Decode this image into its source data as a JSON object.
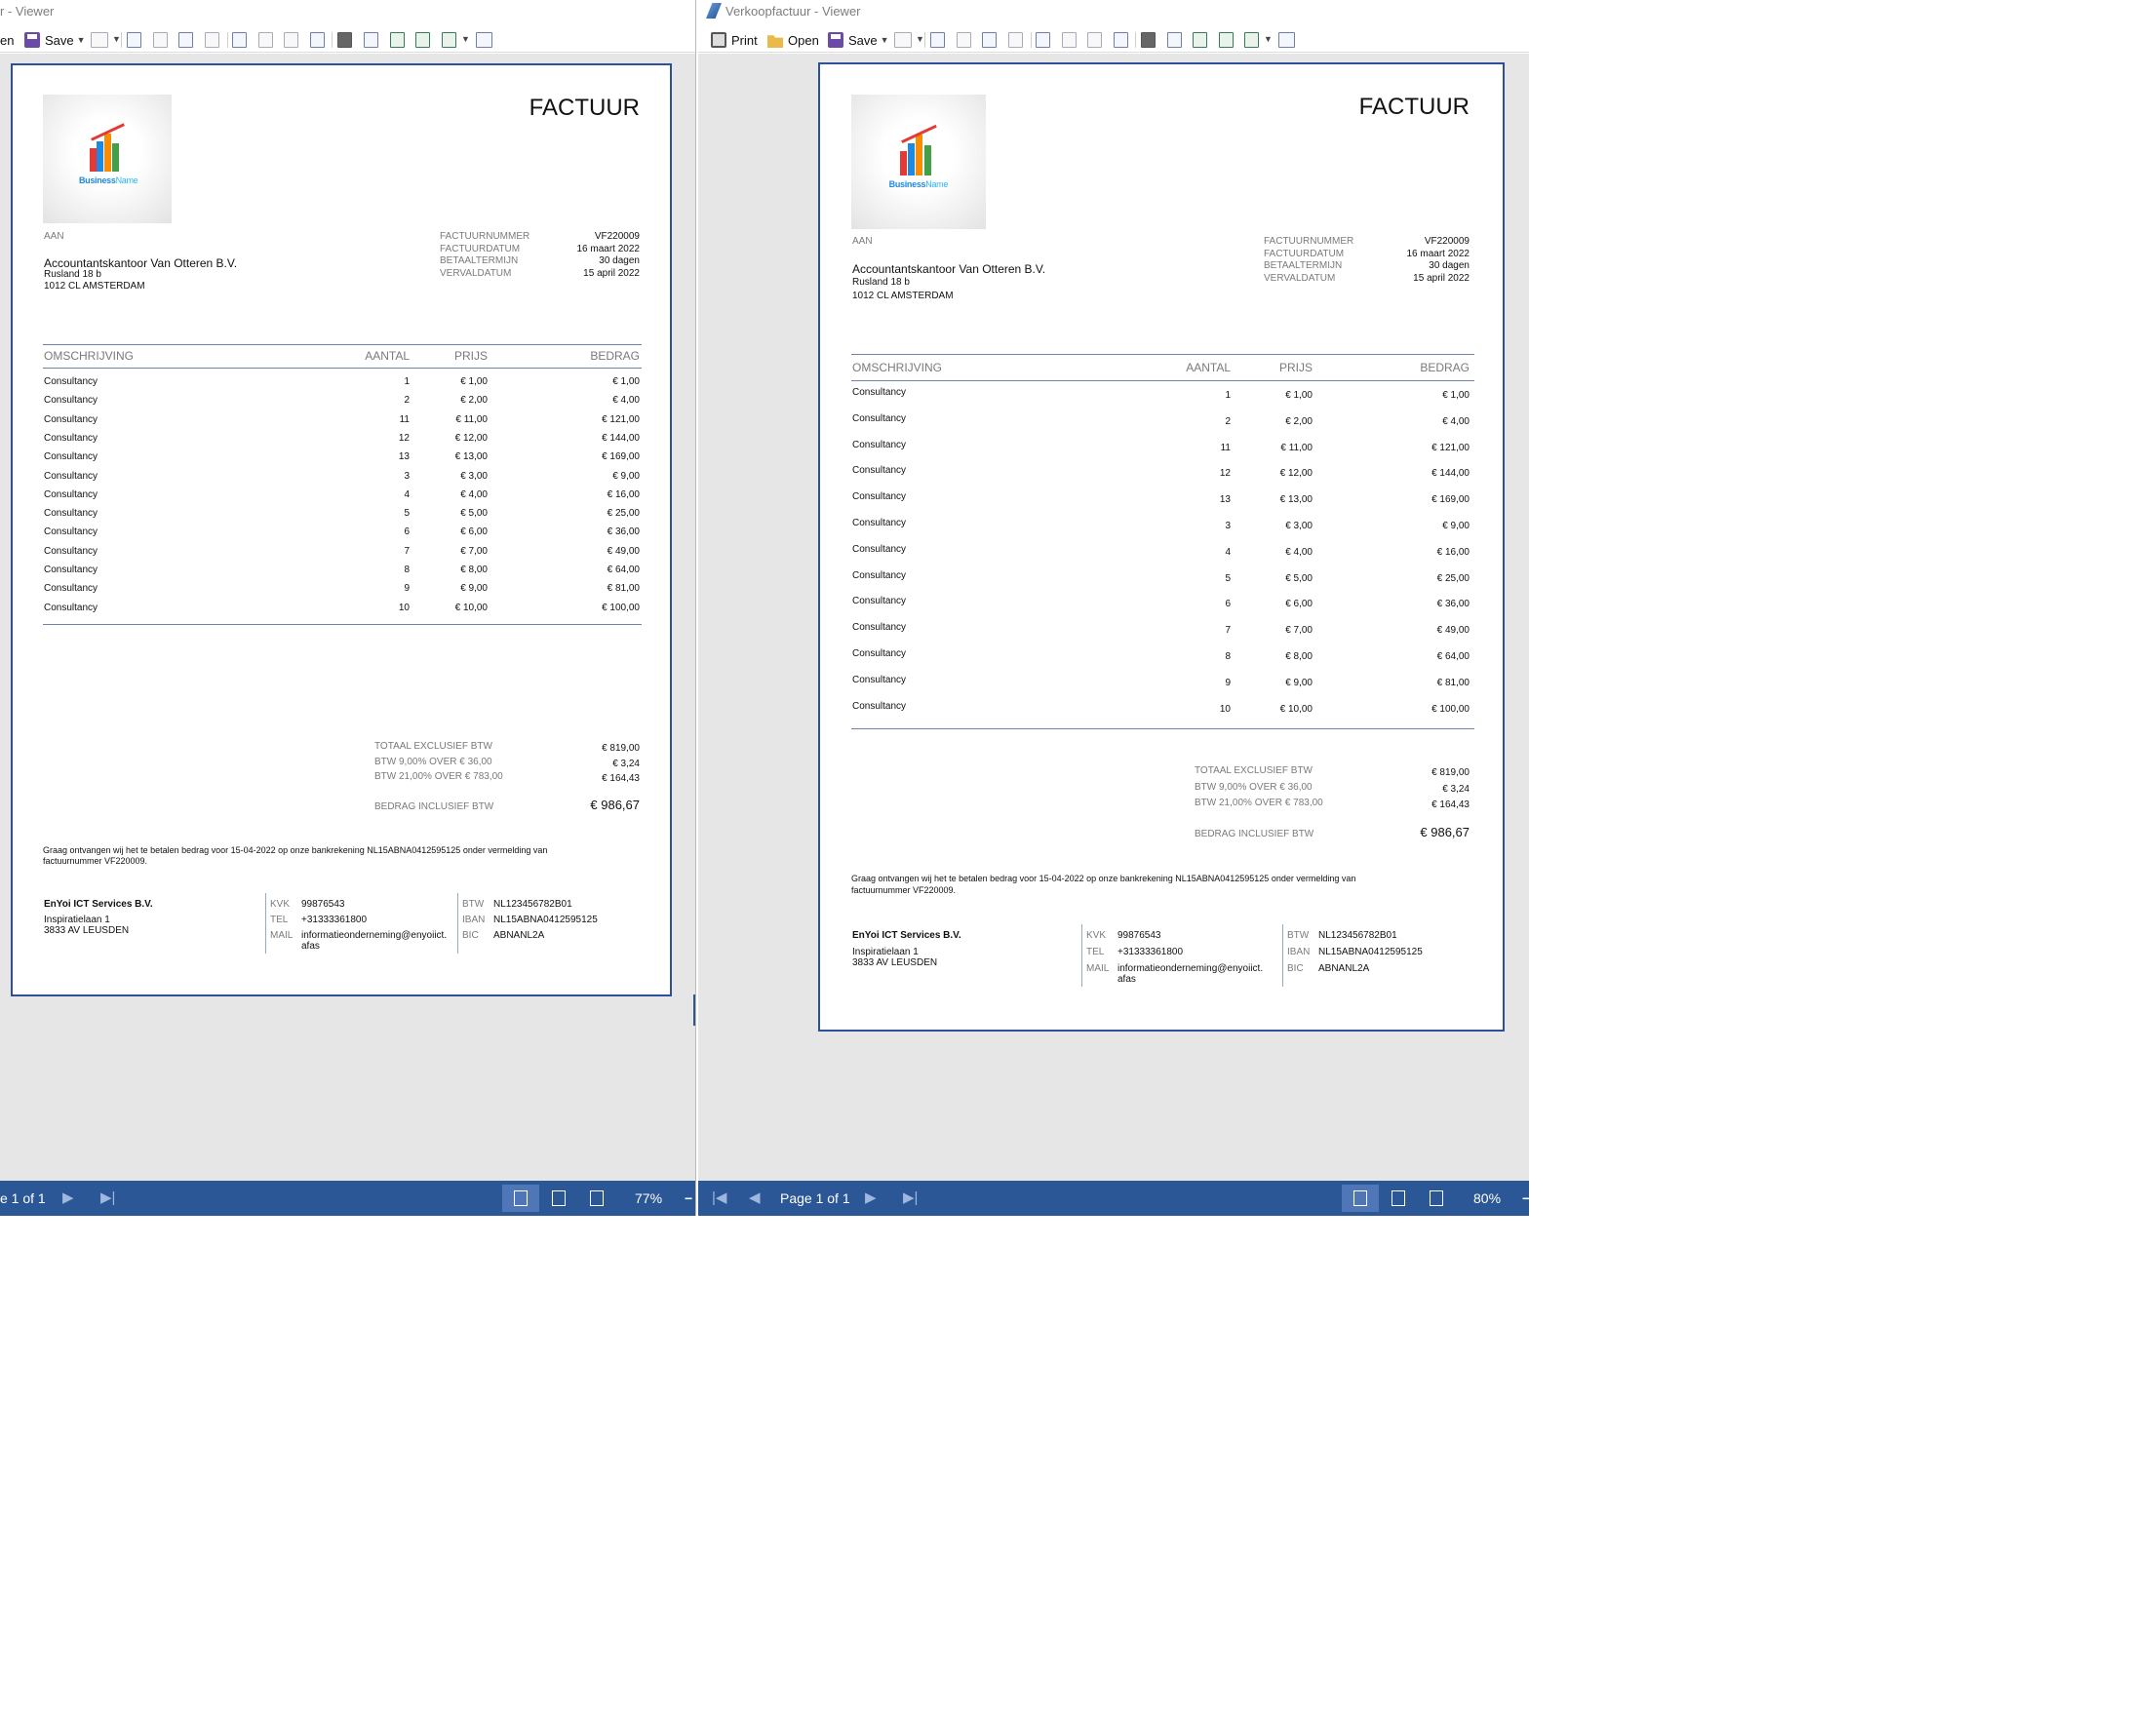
{
  "left_window": {
    "title": "r - Viewer",
    "toolbar": {
      "open_label": "en",
      "save_label": "Save"
    },
    "status": {
      "page_text": "e 1 of 1",
      "zoom": "77%"
    }
  },
  "right_window": {
    "title": "Verkoopfactuur - Viewer",
    "toolbar": {
      "print_label": "Print",
      "open_label": "Open",
      "save_label": "Save"
    },
    "status": {
      "page_text": "Page 1 of 1",
      "zoom": "80%"
    }
  },
  "invoice": {
    "heading": "FACTUUR",
    "logo_text_1": "Business",
    "logo_text_2": "Name",
    "to_label": "AAN",
    "recipient": {
      "name": "Accountantskantoor Van Otteren B.V.",
      "address": "Rusland 18 b",
      "city": "1012 CL AMSTERDAM"
    },
    "meta": [
      {
        "label": "FACTUURNUMMER",
        "value": "VF220009"
      },
      {
        "label": "FACTUURDATUM",
        "value": "16 maart 2022"
      },
      {
        "label": "BETAALTERMIJN",
        "value": "30 dagen"
      },
      {
        "label": "VERVALDATUM",
        "value": "15 april 2022"
      }
    ],
    "columns": {
      "description": "OMSCHRIJVING",
      "quantity": "AANTAL",
      "price": "PRIJS",
      "amount": "BEDRAG"
    },
    "lines": [
      {
        "description": "Consultancy",
        "quantity": "1",
        "price": "€ 1,00",
        "amount": "€ 1,00"
      },
      {
        "description": "Consultancy",
        "quantity": "2",
        "price": "€ 2,00",
        "amount": "€ 4,00"
      },
      {
        "description": "Consultancy",
        "quantity": "11",
        "price": "€ 11,00",
        "amount": "€ 121,00"
      },
      {
        "description": "Consultancy",
        "quantity": "12",
        "price": "€ 12,00",
        "amount": "€ 144,00"
      },
      {
        "description": "Consultancy",
        "quantity": "13",
        "price": "€ 13,00",
        "amount": "€ 169,00"
      },
      {
        "description": "Consultancy",
        "quantity": "3",
        "price": "€ 3,00",
        "amount": "€ 9,00"
      },
      {
        "description": "Consultancy",
        "quantity": "4",
        "price": "€ 4,00",
        "amount": "€ 16,00"
      },
      {
        "description": "Consultancy",
        "quantity": "5",
        "price": "€ 5,00",
        "amount": "€ 25,00"
      },
      {
        "description": "Consultancy",
        "quantity": "6",
        "price": "€ 6,00",
        "amount": "€ 36,00"
      },
      {
        "description": "Consultancy",
        "quantity": "7",
        "price": "€ 7,00",
        "amount": "€ 49,00"
      },
      {
        "description": "Consultancy",
        "quantity": "8",
        "price": "€ 8,00",
        "amount": "€ 64,00"
      },
      {
        "description": "Consultancy",
        "quantity": "9",
        "price": "€ 9,00",
        "amount": "€ 81,00"
      },
      {
        "description": "Consultancy",
        "quantity": "10",
        "price": "€ 10,00",
        "amount": "€ 100,00"
      }
    ],
    "totals": [
      {
        "label": "TOTAAL EXCLUSIEF BTW",
        "value": "€ 819,00"
      },
      {
        "label": "BTW 9,00% OVER € 36,00",
        "value": "€ 3,24"
      },
      {
        "label": "BTW 21,00% OVER € 783,00",
        "value": "€ 164,43"
      }
    ],
    "grand_total": {
      "label": "BEDRAG INCLUSIEF BTW",
      "value": "€ 986,67"
    },
    "payment_note_1": "Graag ontvangen wij het te betalen bedrag voor 15-04-2022 op onze bankrekening NL15ABNA0412595125 onder vermelding van",
    "payment_note_2": "factuurnummer VF220009.",
    "company": {
      "name": "EnYoi ICT Services B.V.",
      "address": "Inspiratielaan 1",
      "city": "3833 AV LEUSDEN",
      "kvk_label": "KVK",
      "kvk": "99876543",
      "tel_label": "TEL",
      "tel": "+31333361800",
      "mail_label": "MAIL",
      "mail_1": "informatieonderneming@enyoiict.",
      "mail_2": "afas",
      "btw_label": "BTW",
      "btw": "NL123456782B01",
      "iban_label": "IBAN",
      "iban": "NL15ABNA0412595125",
      "bic_label": "BIC",
      "bic": "ABNANL2A"
    }
  },
  "colors": {
    "accent": "#2b5797",
    "page_border": "#2e4f9c",
    "workspace": "#e6e6e6"
  }
}
